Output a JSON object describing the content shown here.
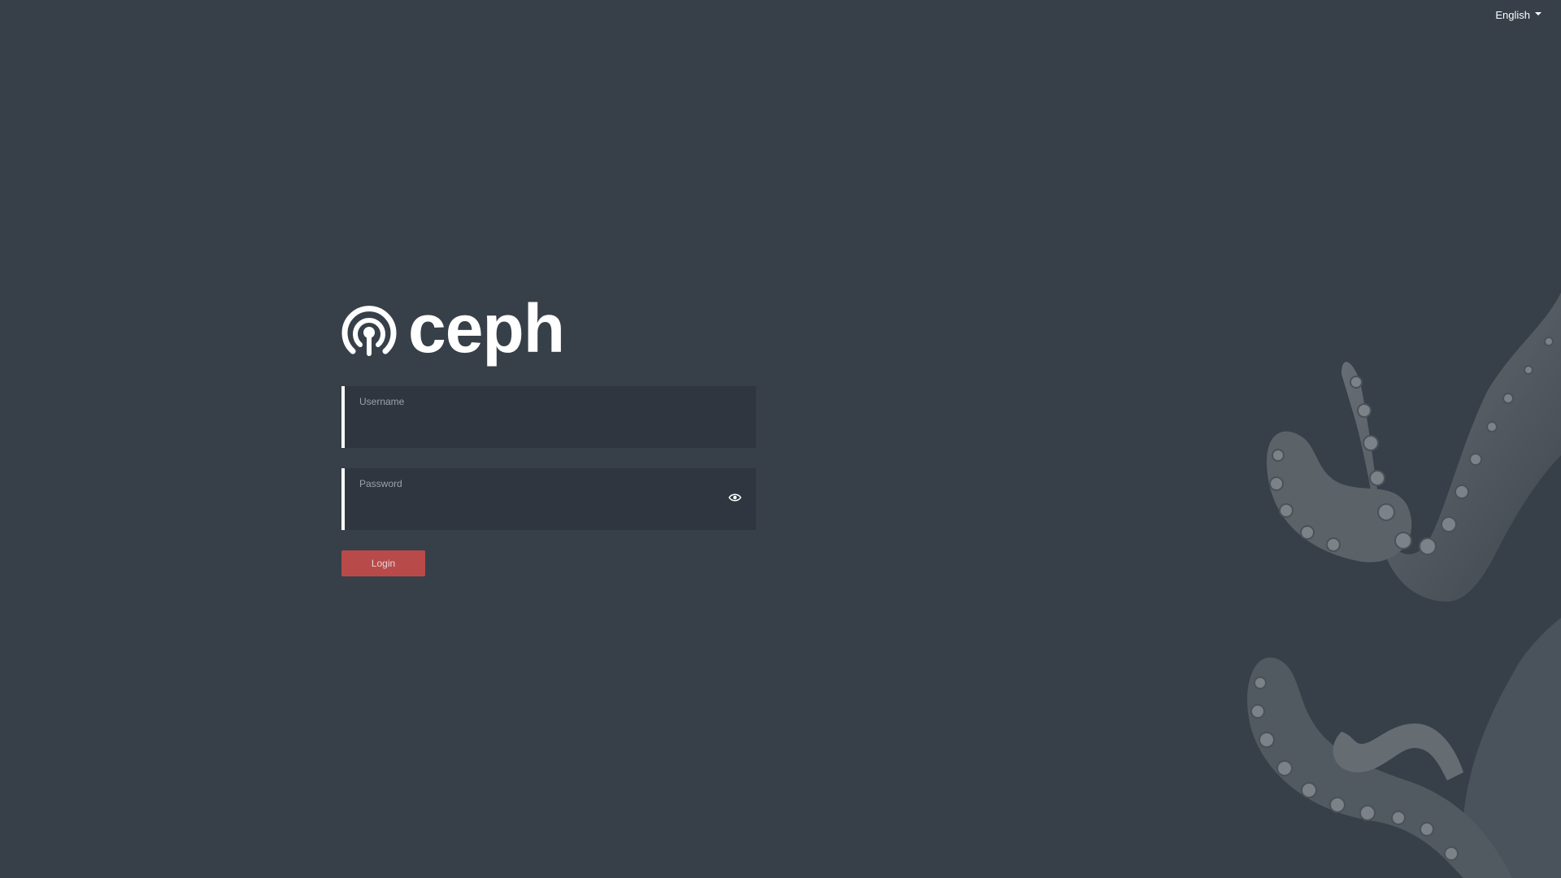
{
  "language": {
    "selected": "English",
    "caret_icon": "chevron-down-icon"
  },
  "logo": {
    "text": "ceph",
    "icon": "ceph-logo-icon",
    "color": "#ffffff"
  },
  "form": {
    "username": {
      "label": "Username",
      "value": ""
    },
    "password": {
      "label": "Password",
      "value": "",
      "toggle_icon": "eye-icon"
    },
    "login_label": "Login"
  },
  "colors": {
    "background": "#374049",
    "field_background": "#2f363f",
    "accent": "#b94a4a"
  },
  "background_image": "octopus-tentacles"
}
